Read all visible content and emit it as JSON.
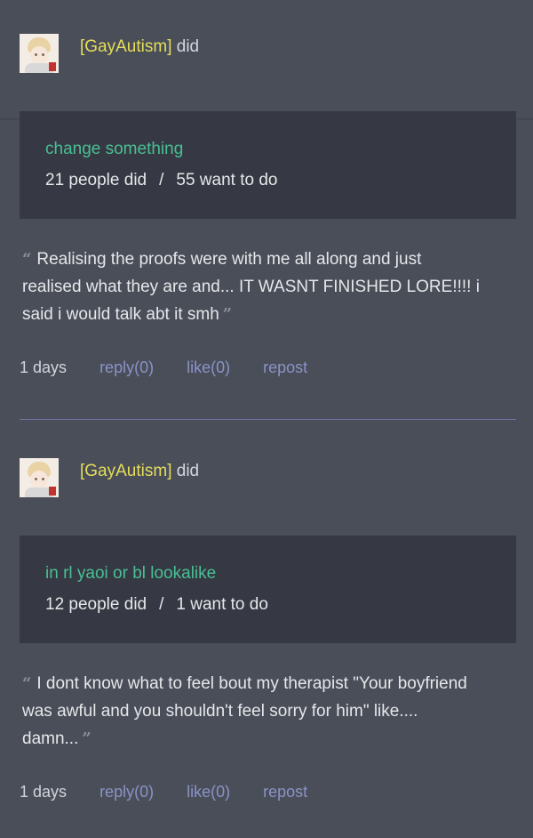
{
  "posts": [
    {
      "username": "[GayAutism]",
      "did_text": "did",
      "task_title": "change something",
      "people_did": "21 people did",
      "separator": "/",
      "want_to_do": "55 want to do",
      "quote_open": "“",
      "quote_text": "Realising the proofs were with me all along and just realised what they are and... IT WASNT FINISHED LORE!!!! i said i would talk abt it smh",
      "quote_close": "”",
      "time": "1 days",
      "reply": "reply(0)",
      "like": "like(0)",
      "repost": "repost"
    },
    {
      "username": "[GayAutism]",
      "did_text": "did",
      "task_title": "in rl yaoi or bl lookalike",
      "people_did": "12 people did",
      "separator": "/",
      "want_to_do": "1 want to do",
      "quote_open": "“",
      "quote_text": "I dont know what to feel bout my therapist \"Your boyfriend was awful and you shouldn't feel sorry for him\" like.... damn...",
      "quote_close": "”",
      "time": "1 days",
      "reply": "reply(0)",
      "like": "like(0)",
      "repost": "repost"
    }
  ],
  "icons": {
    "avatar": "avatar-icon"
  },
  "colors": {
    "background": "#4a4e59",
    "card": "#363943",
    "username": "#e5dd5a",
    "task_title": "#49bf94",
    "link": "#8a93c6"
  }
}
